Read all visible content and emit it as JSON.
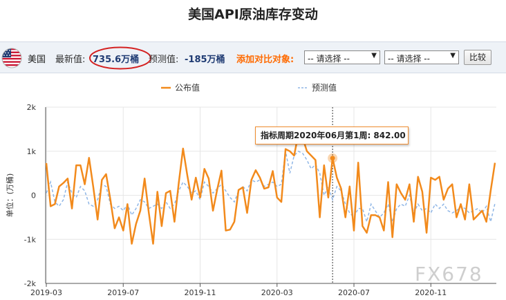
{
  "page": {
    "title": "美国API原油库存变动"
  },
  "info": {
    "country": "美国",
    "latest_label": "最新值:",
    "latest_value": "735.6万桶",
    "forecast_label": "预测值:",
    "forecast_value": "-185万桶",
    "compare_label": "添加对比对象:",
    "select1": "-- 请选择 --",
    "select2": "-- 请选择 --",
    "compare_button": "比较"
  },
  "tooltip": {
    "text": "指标周期2020年06月第1周: 842.00"
  },
  "watermark": "FX678",
  "colors": {
    "actual": "#f28a1c",
    "forecast": "#8fb6e6",
    "accent": "#ff6a00",
    "ring": "#d42020"
  },
  "chart_data": {
    "type": "line",
    "title": "美国API原油库存变动",
    "ylabel": "单位：(万桶)",
    "ylim": [
      -2000,
      2000
    ],
    "yticks": [
      2000,
      1000,
      0,
      -1000,
      -2000
    ],
    "ytick_labels": [
      "2k",
      "1k",
      "0",
      "-1k",
      "-2k"
    ],
    "xtick_labels": [
      "2019-03",
      "2019-07",
      "2019-11",
      "2020-03",
      "2020-07",
      "2020-11"
    ],
    "legend_position": "top",
    "highlight": {
      "period": "2020年06月第1周",
      "value": 842
    },
    "series": [
      {
        "name": "公布值",
        "values": [
          730,
          -250,
          -200,
          200,
          280,
          380,
          -300,
          680,
          680,
          250,
          850,
          180,
          -550,
          350,
          480,
          -100,
          -750,
          -500,
          -800,
          -200,
          -1100,
          -650,
          -350,
          380,
          -400,
          -1100,
          80,
          -700,
          50,
          100,
          -600,
          280,
          1060,
          450,
          -100,
          400,
          -50,
          600,
          380,
          -350,
          130,
          560,
          -800,
          -780,
          -600,
          120,
          180,
          -400,
          350,
          570,
          400,
          150,
          180,
          550,
          -50,
          -150,
          1050,
          1000,
          900,
          1400,
          1300,
          1000,
          900,
          800,
          -500,
          680,
          -50,
          842,
          400,
          150,
          -500,
          200,
          -800,
          740,
          -700,
          -850,
          -450,
          -450,
          -500,
          -800,
          300,
          -950,
          250,
          50,
          -100,
          250,
          -600,
          420,
          80,
          -850,
          400,
          350,
          420,
          -100,
          150,
          250,
          -500,
          -200,
          -550,
          250,
          -550,
          -450,
          -350,
          -600,
          100,
          735.6
        ]
      },
      {
        "name": "预测值",
        "values": [
          50,
          300,
          -150,
          -250,
          -100,
          300,
          50,
          -50,
          200,
          100,
          -200,
          -250,
          -100,
          250,
          200,
          -200,
          -300,
          -250,
          -350,
          -200,
          -450,
          -300,
          -100,
          -150,
          -300,
          -250,
          -200,
          -300,
          -150,
          -300,
          -200,
          100,
          300,
          200,
          50,
          100,
          -100,
          300,
          200,
          50,
          150,
          250,
          100,
          -50,
          -150,
          100,
          200,
          100,
          350,
          300,
          350,
          200,
          250,
          300,
          200,
          250,
          1000,
          500,
          900,
          1000,
          950,
          800,
          600,
          700,
          500,
          0,
          200,
          -100,
          200,
          100,
          -200,
          -400,
          -500,
          -300,
          -300,
          -600,
          -200,
          -350,
          -500,
          -400,
          -200,
          -600,
          -300,
          -200,
          -250,
          0,
          -400,
          -200,
          -350,
          -300,
          -400,
          -200,
          -300,
          -200,
          -350,
          -400,
          -350,
          -250,
          -300,
          -400,
          -350,
          -300,
          -400,
          -250,
          -600,
          -185
        ]
      }
    ]
  }
}
